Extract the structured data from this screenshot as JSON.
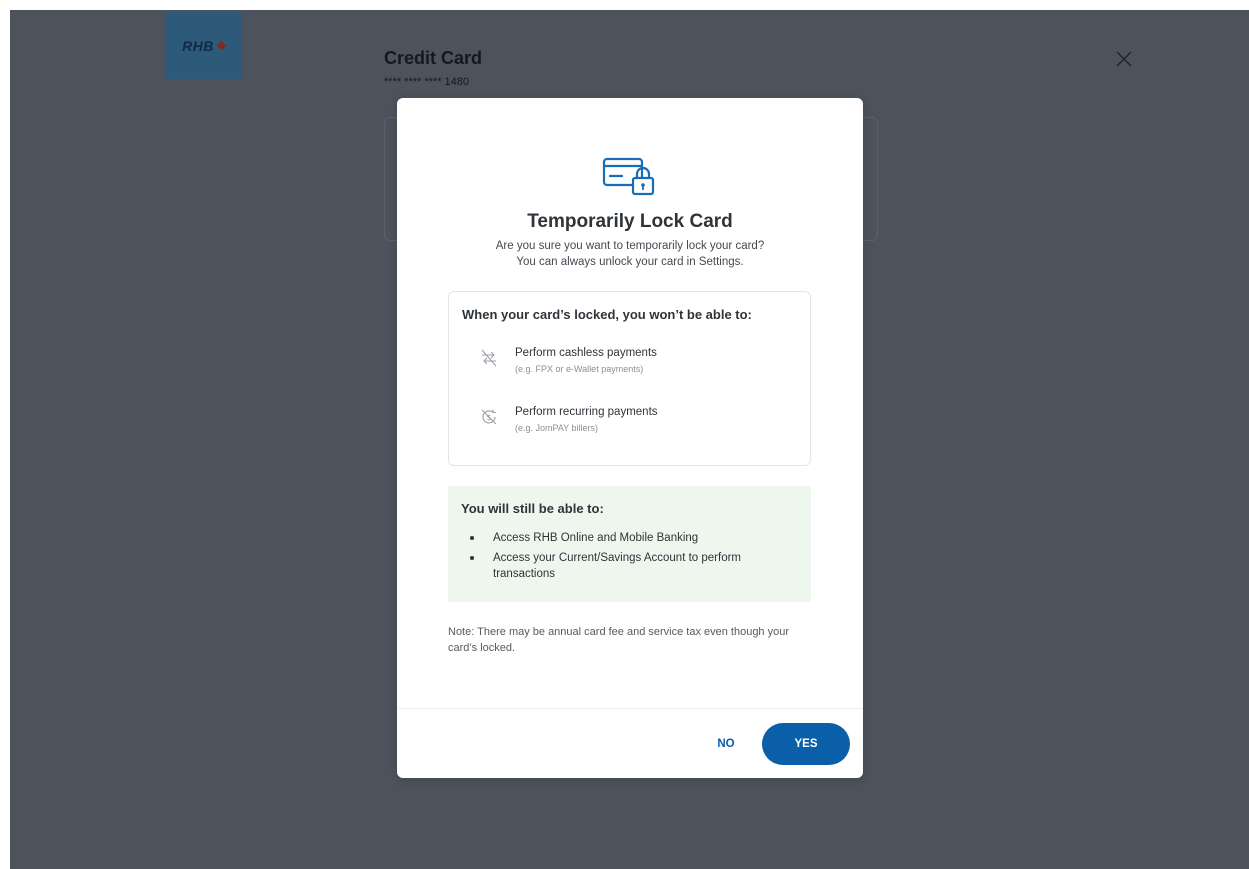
{
  "brand": {
    "logo_text": "RHB",
    "accent_color": "#0b5ea8"
  },
  "header": {
    "title": "Credit Card",
    "card_number": "**** **** **** 1480",
    "close_icon": "close-icon"
  },
  "modal": {
    "icon": "card-lock-icon",
    "title": "Temporarily Lock Card",
    "subtitle_line1": "Are you sure you want to temporarily lock your card?",
    "subtitle_line2": "You can always unlock your card in Settings.",
    "restrictions": {
      "heading": "When your card’s locked, you won’t be able to:",
      "items": [
        {
          "icon": "cashless-payment-blocked-icon",
          "label": "Perform cashless payments",
          "note": "(e.g. FPX or e-Wallet payments)"
        },
        {
          "icon": "recurring-payment-blocked-icon",
          "label": "Perform recurring payments",
          "note": "(e.g. JomPAY billers)"
        }
      ]
    },
    "allowed": {
      "heading": "You will still be able to:",
      "items": [
        "Access RHB Online and Mobile Banking",
        "Access your Current/Savings Account to perform transactions"
      ],
      "background_color": "#edf7ee"
    },
    "note": "Note: There may be annual card fee and service tax even though your card’s locked.",
    "buttons": {
      "no_label": "NO",
      "yes_label": "YES"
    }
  }
}
